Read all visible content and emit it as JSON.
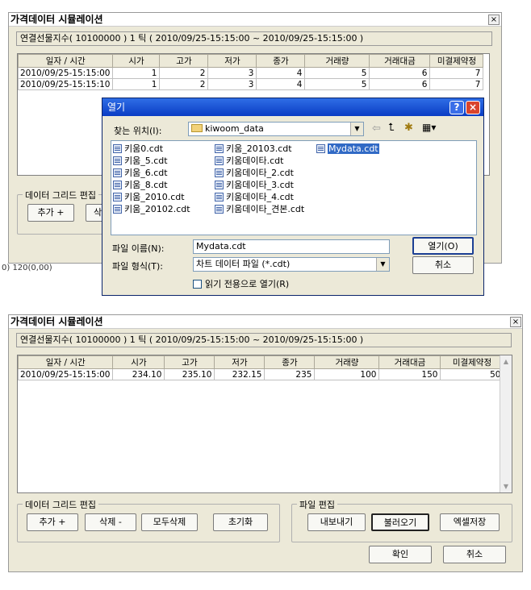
{
  "window_top": {
    "title": "가격데이터 시뮬레이션",
    "close": "×",
    "info": "연결선물지수( 10100000 ) 1 틱 ( 2010/09/25-15:15:00 ~ 2010/09/25-15:15:00 )",
    "columns": [
      "일자 / 시간",
      "시가",
      "고가",
      "저가",
      "종가",
      "거래량",
      "거래대금",
      "미결제약정"
    ],
    "rows": [
      [
        "2010/09/25-15:15:00",
        "1",
        "2",
        "3",
        "4",
        "5",
        "6",
        "7"
      ],
      [
        "2010/09/25-15:15:10",
        "1",
        "2",
        "3",
        "4",
        "5",
        "6",
        "7"
      ]
    ],
    "group_grid_label": "데이터 그리드 편집",
    "add_button": "추가 +",
    "delete_button_partial": "삭",
    "status_text": "0)  120(0,00)"
  },
  "open_dialog": {
    "title": "열기",
    "help": "?",
    "close": "×",
    "lookin_label": "찾는 위치(I):",
    "lookin_value": "kiwoom_data",
    "files_col1": [
      "키움0.cdt",
      "키움_5.cdt",
      "키움_6.cdt",
      "키움_8.cdt",
      "키움_2010.cdt",
      "키움_20102.cdt"
    ],
    "files_col2": [
      "키움_20103.cdt",
      "키움데이타.cdt",
      "키움데이타_2.cdt",
      "키움데이타_3.cdt",
      "키움데이타_4.cdt",
      "키움데이타_견본.cdt"
    ],
    "files_col3": [
      "Mydata.cdt"
    ],
    "filename_label": "파일 이름(N):",
    "filename_value": "Mydata.cdt",
    "filetype_label": "파일 형식(T):",
    "filetype_value": "차트 데이터 파일 (*.cdt)",
    "readonly_label": "읽기 전용으로 열기(R)",
    "open_button": "열기(O)",
    "cancel_button": "취소"
  },
  "window_bottom": {
    "title": "가격데이터 시뮬레이션",
    "close": "×",
    "info": "연결선물지수( 10100000 ) 1 틱 ( 2010/09/25-15:15:00 ~ 2010/09/25-15:15:00 )",
    "columns": [
      "일자 / 시간",
      "시가",
      "고가",
      "저가",
      "종가",
      "거래량",
      "거래대금",
      "미결제약정"
    ],
    "rows": [
      [
        "2010/09/25-15:15:00",
        "234.10",
        "235.10",
        "232.15",
        "235",
        "100",
        "150",
        "50"
      ]
    ],
    "group_grid_label": "데이터 그리드 편집",
    "add_button": "추가 +",
    "delete_button": "삭제 -",
    "delete_all_button": "모두삭제",
    "reset_button": "초기화",
    "group_file_label": "파일 편집",
    "export_button": "내보내기",
    "import_button": "불러오기",
    "excel_button": "엑셀저장",
    "ok_button": "확인",
    "cancel_button": "취소"
  }
}
